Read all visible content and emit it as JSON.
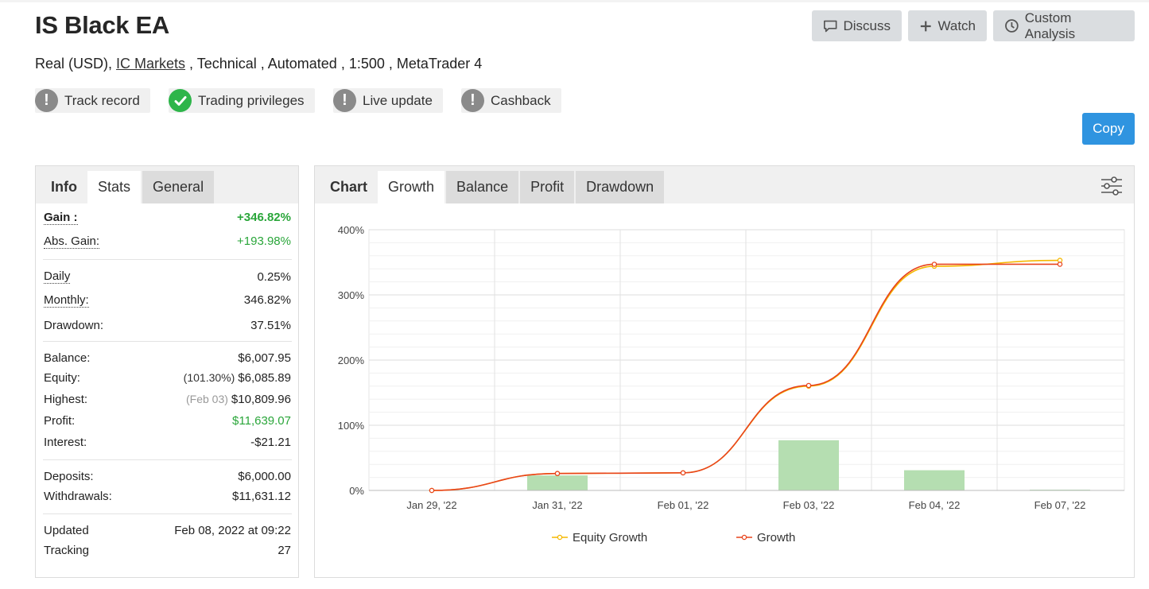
{
  "header": {
    "title": "IS Black EA",
    "subtitle_prefix": "Real (USD), ",
    "broker_link": "IC Markets",
    "subtitle_suffix": " , Technical , Automated , 1:500 , MetaTrader 4"
  },
  "actions": {
    "discuss": "Discuss",
    "watch": "Watch",
    "custom_analysis": "Custom Analysis",
    "copy": "Copy"
  },
  "badges": [
    {
      "label": "Track record",
      "icon": "warning-icon"
    },
    {
      "label": "Trading privileges",
      "icon": "check-icon"
    },
    {
      "label": "Live update",
      "icon": "warning-icon"
    },
    {
      "label": "Cashback",
      "icon": "warning-icon"
    }
  ],
  "left_panel": {
    "tabs": [
      "Info",
      "Stats",
      "General"
    ],
    "stats": {
      "gain_label": "Gain :",
      "gain_value": "+346.82%",
      "abs_gain_label": "Abs. Gain:",
      "abs_gain_value": "+193.98%",
      "daily_label": "Daily",
      "daily_value": "0.25%",
      "monthly_label": "Monthly:",
      "monthly_value": "346.82%",
      "drawdown_label": "Drawdown:",
      "drawdown_value": "37.51%",
      "balance_label": "Balance:",
      "balance_value": "$6,007.95",
      "equity_label": "Equity:",
      "equity_pct": "(101.30%)",
      "equity_value": "$6,085.89",
      "highest_label": "Highest:",
      "highest_date": "(Feb 03)",
      "highest_value": "$10,809.96",
      "profit_label": "Profit:",
      "profit_value": "$11,639.07",
      "interest_label": "Interest:",
      "interest_value": "-$21.21",
      "deposits_label": "Deposits:",
      "deposits_value": "$6,000.00",
      "withdrawals_label": "Withdrawals:",
      "withdrawals_value": "$11,631.12",
      "updated_label": "Updated",
      "updated_value": "Feb 08, 2022 at 09:22",
      "tracking_label": "Tracking",
      "tracking_value": "27"
    }
  },
  "right_panel": {
    "tabs": [
      "Chart",
      "Growth",
      "Balance",
      "Profit",
      "Drawdown"
    ]
  },
  "colors": {
    "equity_line": "#f5b800",
    "growth_line": "#e8431c",
    "bars": "#b5deb1",
    "copy_button": "#2f94e0",
    "green_text": "#2aa63a"
  },
  "chart_data": {
    "type": "line",
    "categories": [
      "Jan 29, '22",
      "Jan 31, '22",
      "Feb 01, '22",
      "Feb 03, '22",
      "Feb 04, '22",
      "Feb 07, '22"
    ],
    "y_ticks": [
      "400%",
      "300%",
      "200%",
      "100%",
      "0%"
    ],
    "ylim": [
      0,
      400
    ],
    "grid": true,
    "legend_position": "bottom",
    "series": [
      {
        "name": "Equity Growth",
        "values": [
          0,
          26,
          27,
          160,
          344,
          353
        ]
      },
      {
        "name": "Growth",
        "values": [
          0,
          26,
          27,
          161,
          347,
          347
        ]
      }
    ],
    "bars": [
      0,
      23,
      0,
      77,
      31,
      1
    ]
  }
}
